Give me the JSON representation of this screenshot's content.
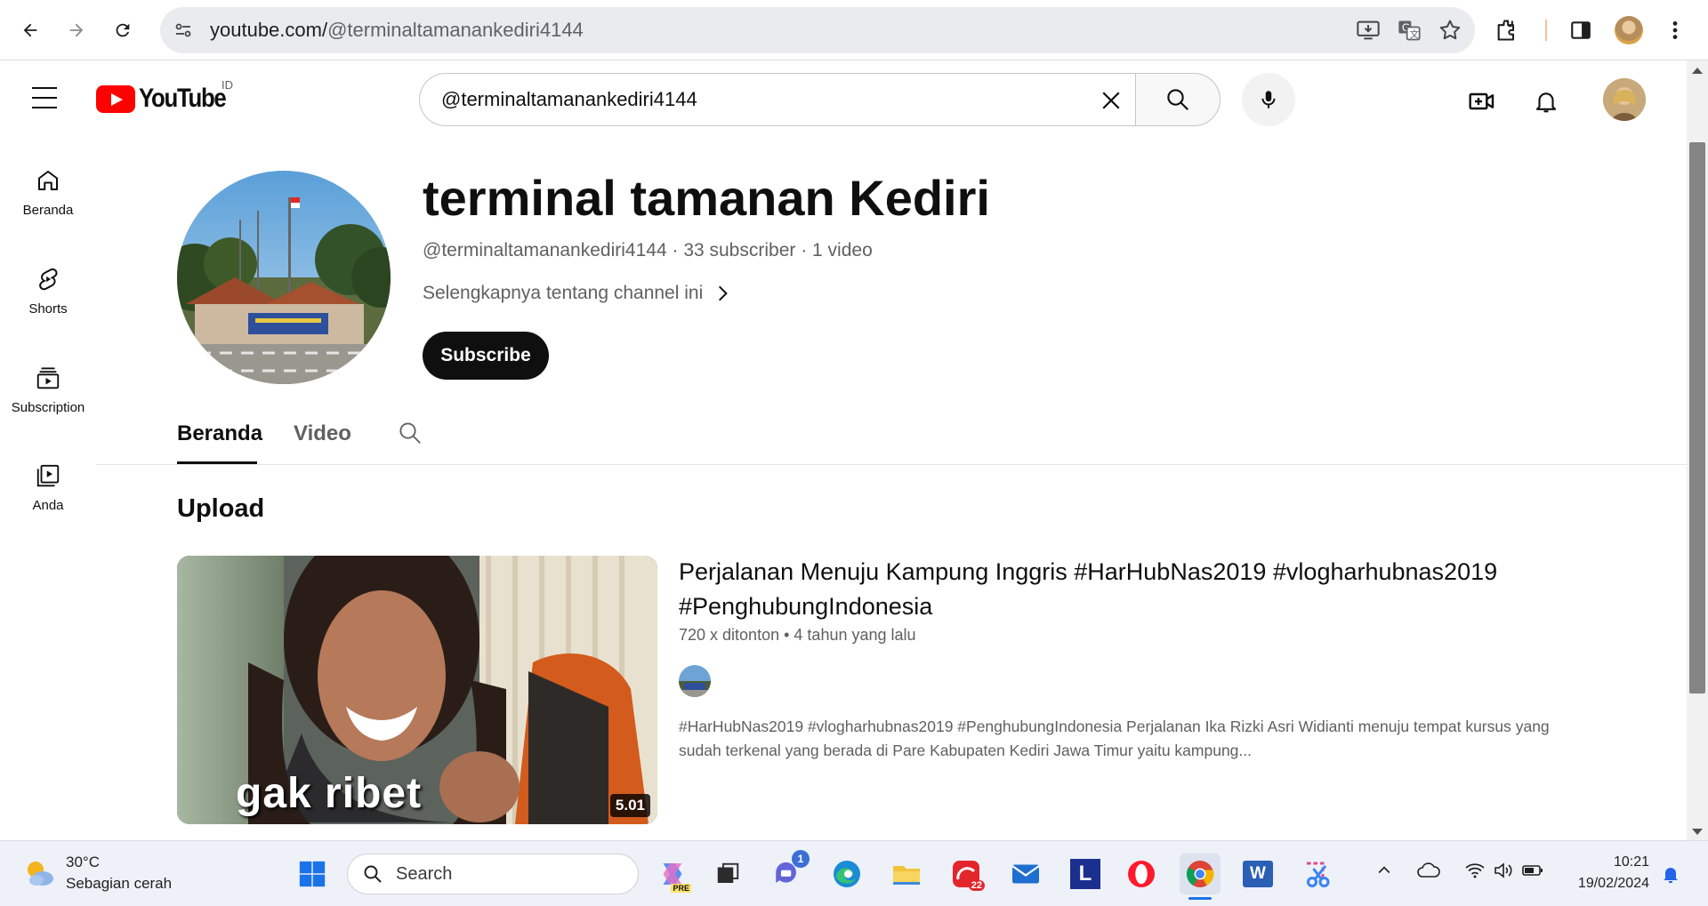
{
  "browser": {
    "url_host": "youtube.com/",
    "url_path": "@terminaltamanankediri4144"
  },
  "masthead": {
    "logo_text": "YouTube",
    "region": "ID",
    "search_value": "@terminaltamanankediri4144"
  },
  "guide": {
    "items": [
      {
        "label": "Beranda",
        "icon": "home-icon"
      },
      {
        "label": "Shorts",
        "icon": "shorts-icon"
      },
      {
        "label": "Subscription",
        "icon": "subscriptions-icon"
      },
      {
        "label": "Anda",
        "icon": "you-icon"
      }
    ]
  },
  "channel": {
    "title": "terminal tamanan Kediri",
    "handle": "@terminaltamanankediri4144",
    "subscribers": "33 subscriber",
    "videos": "1 video",
    "more_label": "Selengkapnya tentang channel ini",
    "subscribe_label": "Subscribe"
  },
  "tabs": [
    {
      "label": "Beranda",
      "active": true
    },
    {
      "label": "Video",
      "active": false
    }
  ],
  "section": {
    "title": "Upload"
  },
  "video": {
    "title": "Perjalanan Menuju Kampung Inggris #HarHubNas2019 #vlogharhubnas2019 #PenghubungIndonesia",
    "views": "720 x ditonton",
    "age": "4 tahun yang lalu",
    "duration": "5.01",
    "thumb_caption": "gak ribet",
    "description": "#HarHubNas2019 #vlogharhubnas2019 #PenghubungIndonesia Perjalanan Ika Rizki Asri Widianti menuju tempat kursus yang sudah terkenal yang berada di Pare Kabupaten Kediri Jawa Timur yaitu kampung..."
  },
  "taskbar": {
    "temperature": "30°C",
    "weather": "Sebagian cerah",
    "search_placeholder": "Search",
    "copilot_badge": "PRE",
    "teams_badge": "1",
    "app_badge": "22",
    "l_app_letter": "L",
    "word_letter": "W",
    "time": "10:21",
    "date": "19/02/2024"
  },
  "colors": {
    "youtube_red": "#ff0000",
    "subscribe_bg": "#0f0f0f",
    "text_secondary": "#606060",
    "taskbar_bg": "#eef1f7"
  }
}
